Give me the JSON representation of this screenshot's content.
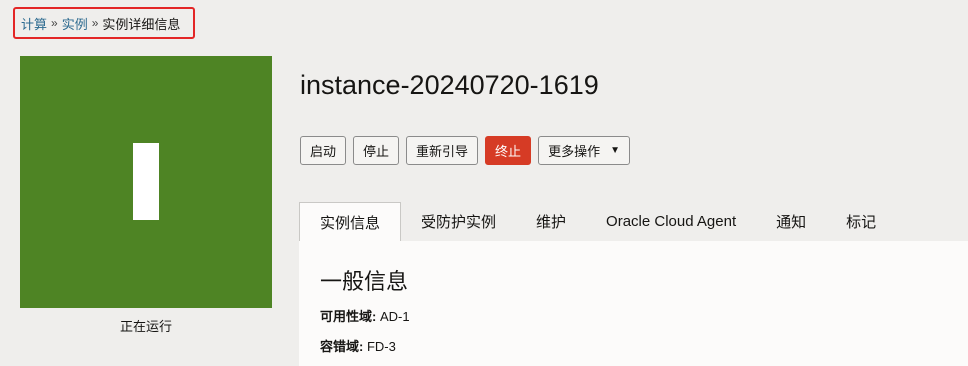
{
  "breadcrumb": {
    "items": [
      "计算",
      "实例",
      "实例详细信息"
    ],
    "separator": "»"
  },
  "instance": {
    "initial": "I",
    "status": "正在运行",
    "name": "instance-20240720-1619",
    "tile_color": "#4e8424"
  },
  "actions": {
    "start": "启动",
    "stop": "停止",
    "reboot": "重新引导",
    "terminate": "终止",
    "more": "更多操作"
  },
  "tabs": [
    "实例信息",
    "受防护实例",
    "维护",
    "Oracle Cloud Agent",
    "通知",
    "标记"
  ],
  "active_tab": "实例信息",
  "panel": {
    "heading": "一般信息",
    "fields": [
      {
        "label": "可用性域:",
        "value": "AD-1"
      },
      {
        "label": "容错域:",
        "value": "FD-3"
      }
    ]
  },
  "colors": {
    "highlight_border": "#e32626",
    "terminate_button": "#d63b25",
    "link": "#2c6a8f"
  }
}
